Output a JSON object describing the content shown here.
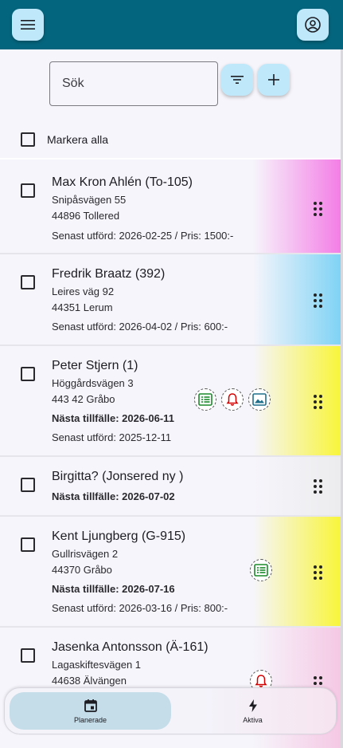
{
  "appbar": {
    "menu_icon": "hamburger-icon",
    "account_icon": "account-circle-icon",
    "color": "#04667e"
  },
  "search": {
    "placeholder": "Sök",
    "value": ""
  },
  "toolbar": {
    "filter_icon": "filter-icon",
    "add_icon": "plus-icon"
  },
  "select_all": {
    "label": "Markera alla",
    "checked": false
  },
  "customers": [
    {
      "name": "Max Kron Ahlén (To-105)",
      "street": "Snipåsvägen 55",
      "city": "44896 Tollered",
      "last_done": "Senast utförd: 2026-02-25 / Pris: 1500:-",
      "accent": "#f47ee6"
    },
    {
      "name": "Fredrik Braatz (392)",
      "street": "Leires väg 92",
      "city": "44351 Lerum",
      "last_done": "Senast utförd: 2026-04-02 / Pris: 600:-",
      "accent": "#7fd3f5"
    },
    {
      "name": "Peter Stjern (1)",
      "street": "Höggårdsvägen 3",
      "city": "443 42 Gråbo",
      "next": "Nästa tillfälle: 2026-06-11",
      "last_done": "Senast utförd: 2025-12-11",
      "badges": [
        "list-icon",
        "bell-icon",
        "image-icon"
      ],
      "accent": "#f8f53a"
    },
    {
      "name": "Birgitta? (Jonsered ny )",
      "next": "Nästa tillfälle: 2026-07-02",
      "accent": "#eeeeee"
    },
    {
      "name": "Kent Ljungberg (G-915)",
      "street": "Gullrisvägen 2",
      "city": "44370 Gråbo",
      "next": "Nästa tillfälle: 2026-07-16",
      "last_done": "Senast utförd: 2026-03-16 / Pris: 800:-",
      "badges": [
        "list-icon"
      ],
      "accent": "#f8f53a"
    },
    {
      "name": "Jasenka Antonsson (Ä-161)",
      "street": "Lagaskiftesvägen 1",
      "city": "44638 Älvängen",
      "badges": [
        "bell-icon"
      ],
      "accent": "#f5c8e4"
    }
  ],
  "bottom_nav": [
    {
      "label": "Planerade",
      "icon": "calendar-icon",
      "active": true
    },
    {
      "label": "Aktiva",
      "icon": "lightning-icon",
      "active": false
    }
  ]
}
